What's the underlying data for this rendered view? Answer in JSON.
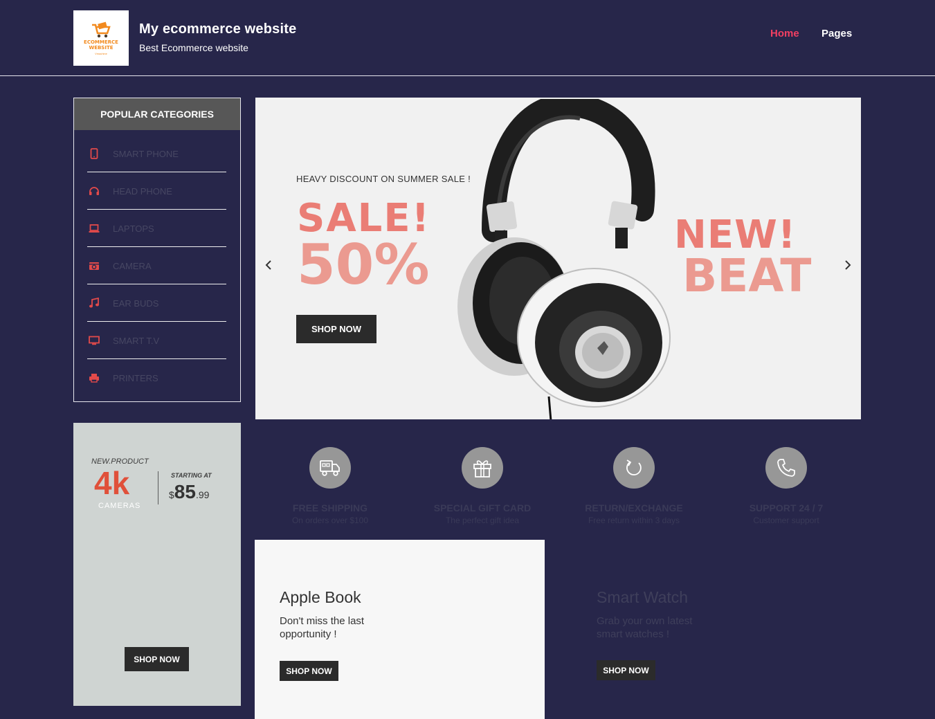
{
  "header": {
    "logo_line1": "ECOMMERCE",
    "logo_line2": "WEBSITE",
    "logo_sub": "Vmachine",
    "title": "My ecommerce website",
    "tagline": "Best Ecommerce website",
    "nav": {
      "home": "Home",
      "pages": "Pages"
    },
    "active_color": "#f23f62"
  },
  "categories": {
    "heading": "POPULAR CATEGORIES",
    "icon_color": "#e24a4a",
    "items": [
      {
        "label": "SMART PHONE",
        "icon": "smartphone-icon"
      },
      {
        "label": "HEAD PHONE",
        "icon": "headphone-icon"
      },
      {
        "label": "LAPTOPS",
        "icon": "laptop-icon"
      },
      {
        "label": "CAMERA",
        "icon": "camera-icon"
      },
      {
        "label": "EAR BUDS",
        "icon": "music-note-icon"
      },
      {
        "label": "SMART T.V",
        "icon": "tv-icon"
      },
      {
        "label": "PRINTERS",
        "icon": "printer-icon"
      }
    ]
  },
  "promo_left": {
    "new_product": "NEW.PRODUCT",
    "headline": "4k",
    "sub": "CAMERAS",
    "starting_at": "STARTING AT",
    "currency": "$",
    "price_whole": "85",
    "price_cents": ".99",
    "button": "SHOP NOW"
  },
  "hero": {
    "subtitle": "HEAVY DISCOUNT ON SUMMER SALE !",
    "sale": "SALE!",
    "percent": "50%",
    "button": "SHOP NOW",
    "new": "NEW!",
    "beat": "BEAT",
    "prev_icon": "chevron-left-icon",
    "next_icon": "chevron-right-icon"
  },
  "features": [
    {
      "title": "FREE SHIPPING",
      "desc": "On orders over $100",
      "icon": "truck-icon"
    },
    {
      "title": "SPECIAL GIFT CARD",
      "desc": "The perfect gift idea",
      "icon": "gift-icon"
    },
    {
      "title": "RETURN/EXCHANGE",
      "desc": "Free return within 3 days",
      "icon": "refresh-icon"
    },
    {
      "title": "SUPPORT 24 / 7",
      "desc": "Customer support",
      "icon": "phone-icon"
    }
  ],
  "promo_book": {
    "title": "Apple Book",
    "desc": "Don't miss the last opportunity !",
    "button": "SHOP NOW"
  },
  "promo_watch": {
    "title": "Smart Watch",
    "desc": "Grab your own latest smart watches !",
    "button": "SHOP NOW"
  }
}
